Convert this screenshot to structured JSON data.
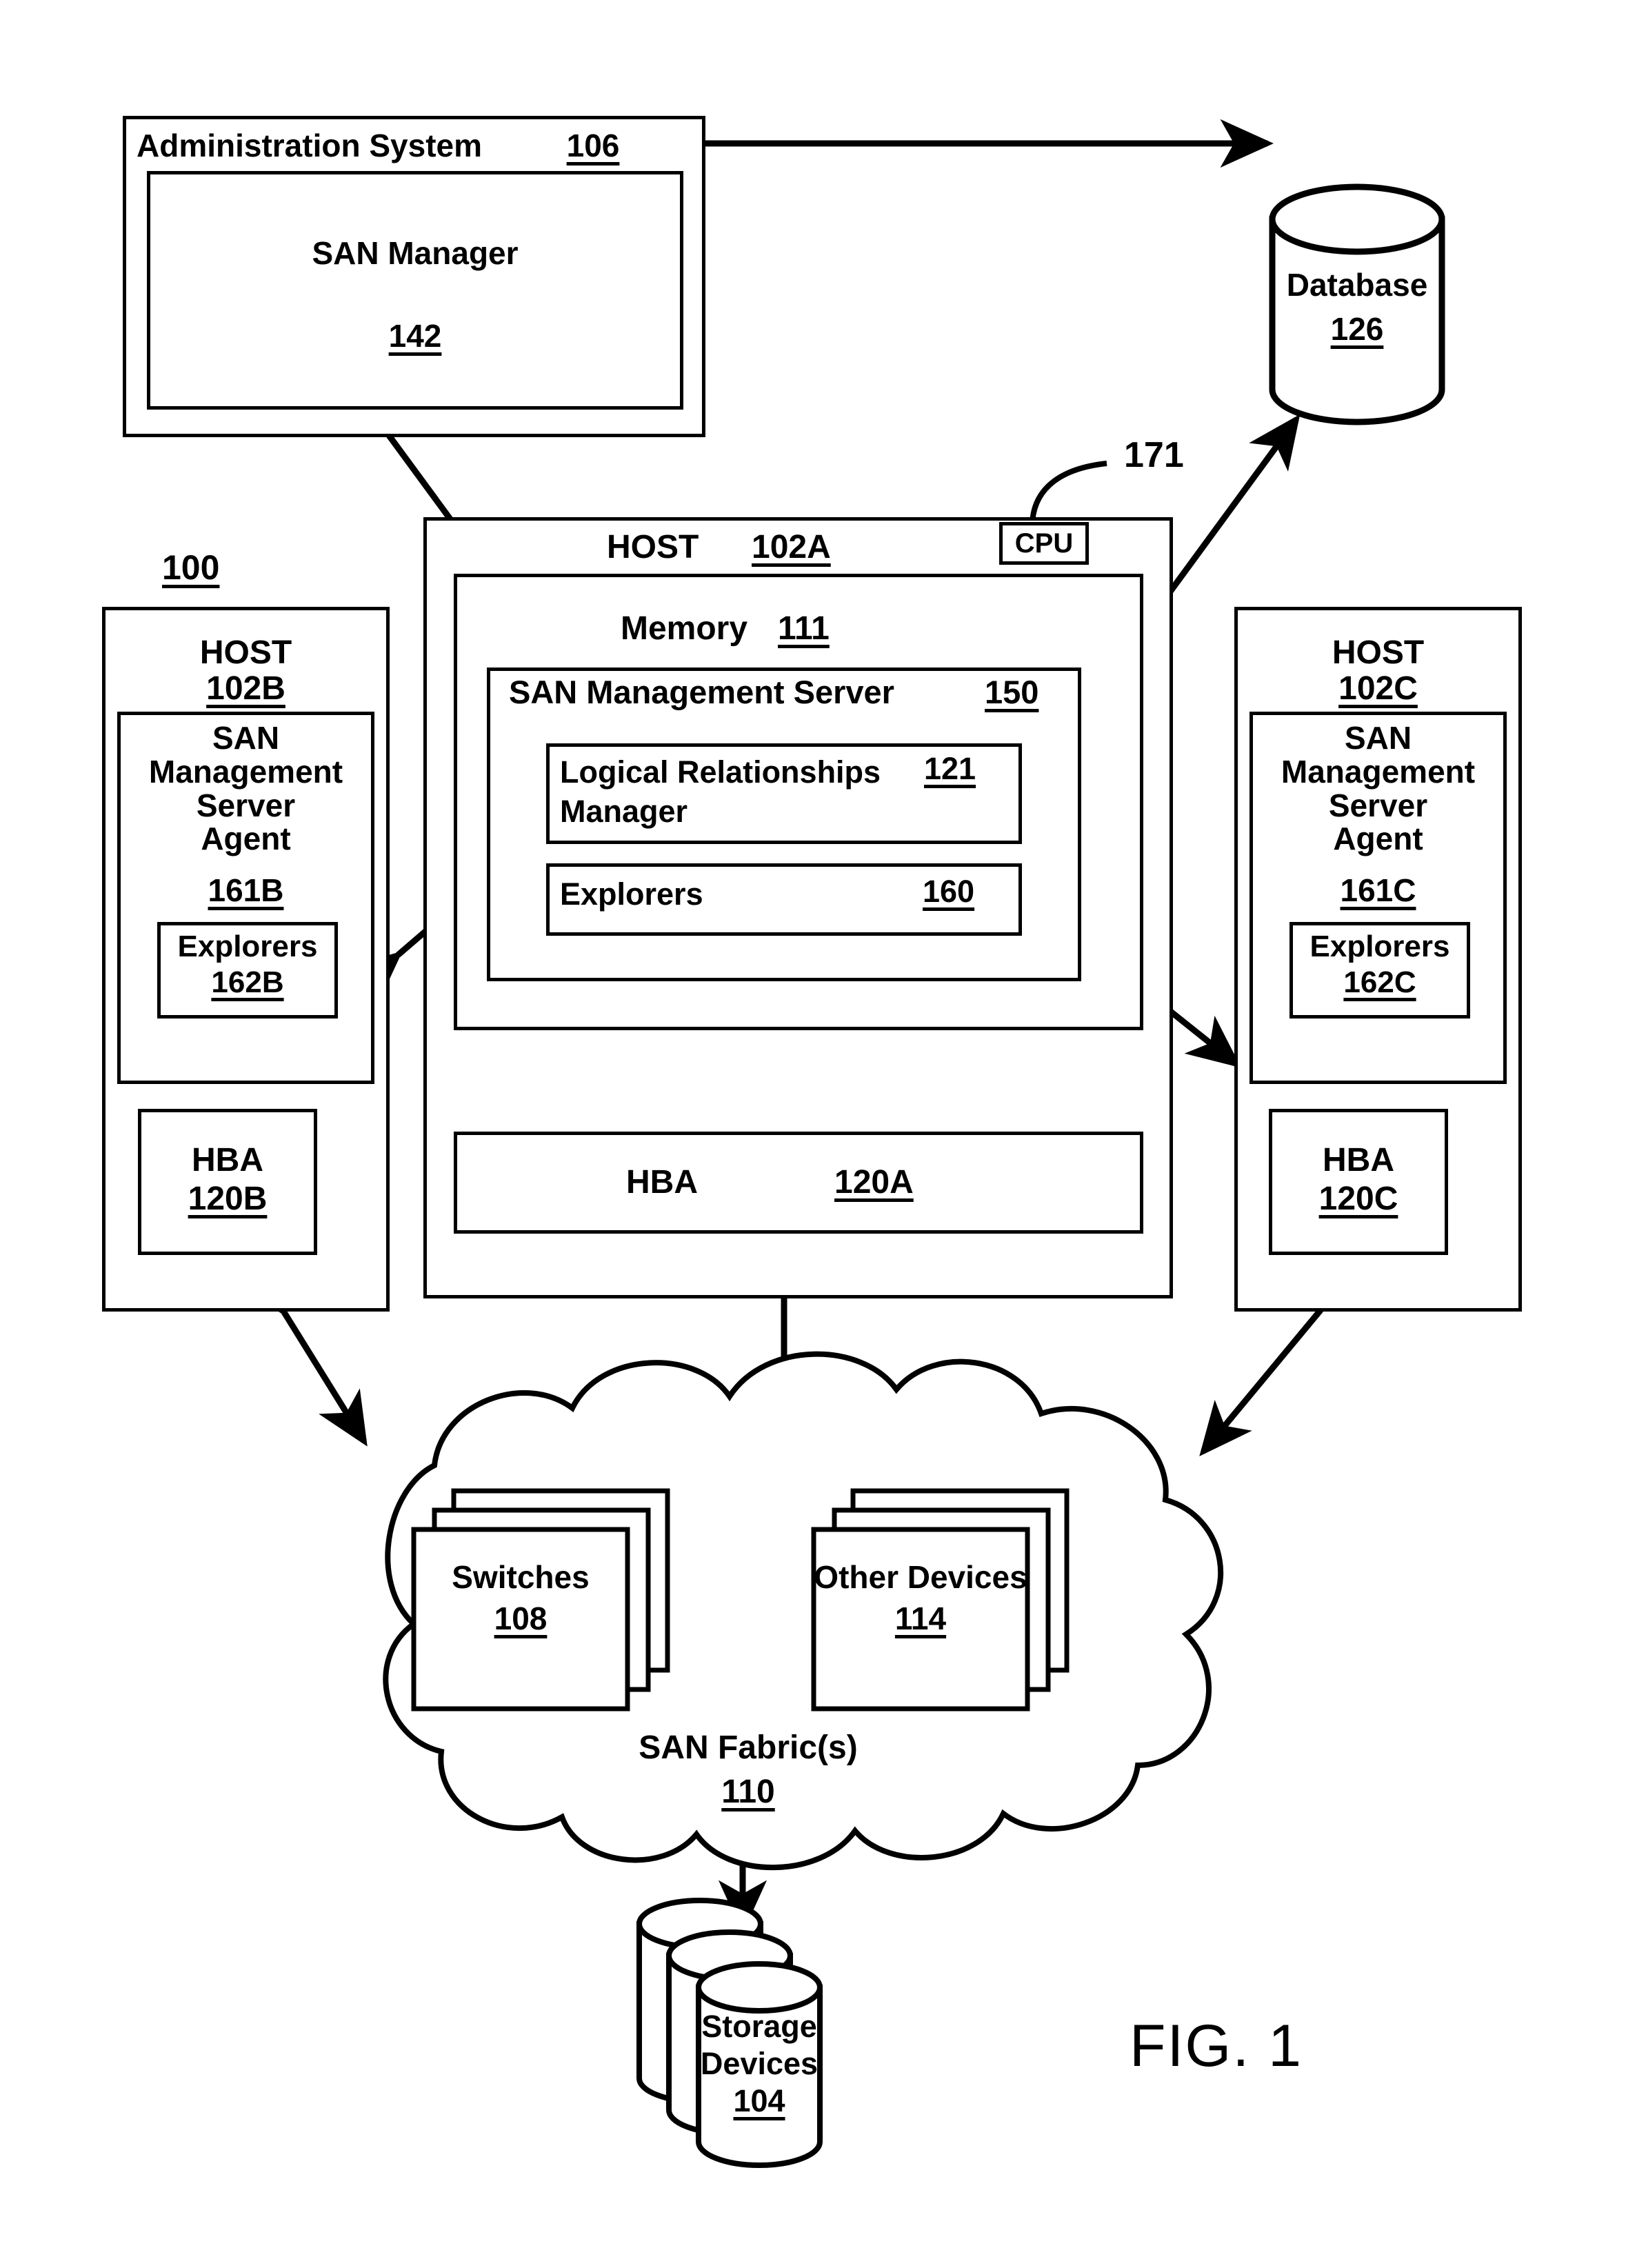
{
  "figure": {
    "caption": "FIG. 1",
    "system_ref": "100",
    "cpu_leader_ref": "171"
  },
  "admin_system": {
    "title": "Administration System",
    "ref": "106",
    "san_manager": {
      "title": "SAN Manager",
      "ref": "142"
    }
  },
  "database": {
    "title": "Database",
    "ref": "126"
  },
  "host_a": {
    "title": "HOST",
    "ref": "102A",
    "cpu_label": "CPU",
    "memory": {
      "title": "Memory",
      "ref": "111"
    },
    "san_management_server": {
      "title": "SAN Management Server",
      "ref": "150",
      "logical_relationships_manager": {
        "line1": "Logical Relationships",
        "line2": "Manager",
        "ref": "121"
      },
      "explorers": {
        "title": "Explorers",
        "ref": "160"
      }
    },
    "hba": {
      "title": "HBA",
      "ref": "120A"
    }
  },
  "host_b": {
    "title": "HOST",
    "ref": "102B",
    "agent": {
      "title": "SAN\nManagement\nServer\nAgent",
      "ref": "161B",
      "explorers": {
        "title": "Explorers",
        "ref": "162B"
      }
    },
    "hba": {
      "title": "HBA",
      "ref": "120B"
    }
  },
  "host_c": {
    "title": "HOST",
    "ref": "102C",
    "agent": {
      "title": "SAN\nManagement\nServer\nAgent",
      "ref": "161C",
      "explorers": {
        "title": "Explorers",
        "ref": "162C"
      }
    },
    "hba": {
      "title": "HBA",
      "ref": "120C"
    }
  },
  "san_fabric": {
    "title": "SAN Fabric(s)",
    "ref": "110",
    "switches": {
      "title": "Switches",
      "ref": "108"
    },
    "other_devices": {
      "title": "Other Devices",
      "ref": "114"
    }
  },
  "storage_devices": {
    "line1": "Storage",
    "line2": "Devices",
    "ref": "104"
  },
  "colors": {
    "line": "#000000",
    "background": "#ffffff"
  }
}
